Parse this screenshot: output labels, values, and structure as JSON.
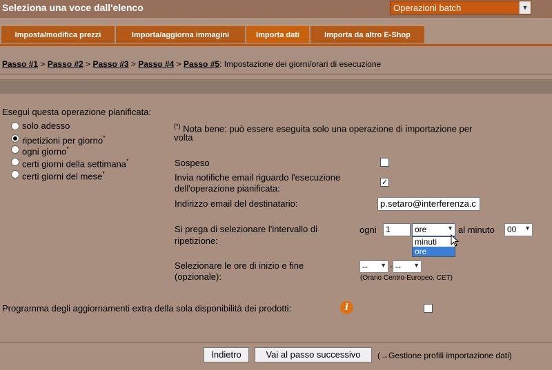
{
  "header": {
    "title": "Seleziona una voce dall'elenco",
    "menu_select": "Operazioni batch"
  },
  "tabs": [
    {
      "label": "Imposta/modifica prezzi",
      "active": false
    },
    {
      "label": "Importa/aggiorna immagini",
      "active": false
    },
    {
      "label": "Importa dati",
      "active": true
    },
    {
      "label": "Importa da altro E-Shop",
      "active": false
    }
  ],
  "breadcrumb": {
    "steps": [
      "Passo #1",
      "Passo #2",
      "Passo #3",
      "Passo #4",
      "Passo #5"
    ],
    "separator": ">",
    "current": ": Impostazione dei giorni/orari di esecuzione"
  },
  "schedule": {
    "heading": "Esegui questa operazione pianificata:",
    "options": [
      {
        "label": "solo adesso",
        "star": "",
        "selected": false
      },
      {
        "label": "ripetizioni per giorno",
        "star": "*",
        "selected": true
      },
      {
        "label": "ogni giorno",
        "star": "*",
        "selected": false
      },
      {
        "label": "certi giorni della settimana",
        "star": "*",
        "selected": false
      },
      {
        "label": "certi giorni del mese",
        "star": "*",
        "selected": false
      }
    ],
    "note_marker": "(*)",
    "note_line1": "Nota bene: può essere eseguita solo una operazione di importazione per",
    "note_line2": "volta"
  },
  "settings": {
    "suspended_label": "Sospeso",
    "suspended_checked": false,
    "notify_label_line1": "Invia notifiche email riguardo l'esecuzione",
    "notify_label_line2": "dell'operazione pianificata:",
    "notify_checked": true,
    "email_label": "Indirizzo email del destinatario:",
    "email_value": "p.setaro@interferenza.c",
    "interval_label_line1": "Si prega di selezionare l'intervallo di",
    "interval_label_line2": "ripetizione:",
    "every_label": "ogni",
    "every_value": "1",
    "unit_value": "ore",
    "unit_options": [
      "minuti",
      "ore"
    ],
    "unit_highlighted": "ore",
    "at_minute_label": "al minuto",
    "minute_value": "00",
    "hours_label_line1": "Selezionare le ore di inizio e fine",
    "hours_label_line2": "(opzionale):",
    "start_value": "--",
    "dash": "-",
    "end_value": "--",
    "timezone_note": "(Orario Centro-Europeo, CET)"
  },
  "extra": {
    "label": "Programma degli aggiornamenti extra della sola disponibilità dei prodotti:",
    "info_icon": "i",
    "checked": false
  },
  "footer": {
    "back_label": "Indietro",
    "next_label": "Vai al passo successivo",
    "profiles_link": "(→Gestione profili importazione dati)"
  }
}
